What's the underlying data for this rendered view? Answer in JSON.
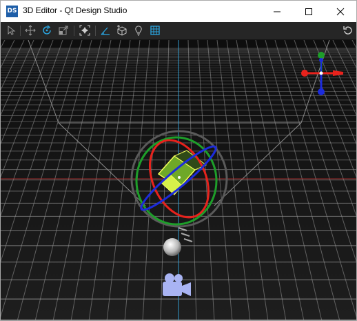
{
  "window": {
    "title": "3D Editor - Qt Design Studio",
    "app_icon_text": "DS"
  },
  "toolbar": {
    "tools": [
      "select-tool-icon",
      "move-tool-icon",
      "rotate-tool-icon",
      "scale-tool-icon",
      "fit-to-view-icon",
      "perspective-toggle-icon",
      "orientation-toggle-icon",
      "light-edit-icon",
      "grid-toggle-icon",
      "reset-view-icon"
    ],
    "active_tools": [
      "rotate-tool-icon",
      "grid-toggle-icon"
    ],
    "accent_color": "#2aa5e0"
  },
  "viewport": {
    "background_color": "#161616",
    "grid_color": "#9a9a9a",
    "selection_color": "#c8f23c",
    "gizmo": {
      "axis_x_color": "#e8221c",
      "axis_y_color": "#1e9e2a",
      "axis_z_color": "#1c2bdc"
    },
    "objects": [
      "cube",
      "light",
      "camera"
    ]
  }
}
